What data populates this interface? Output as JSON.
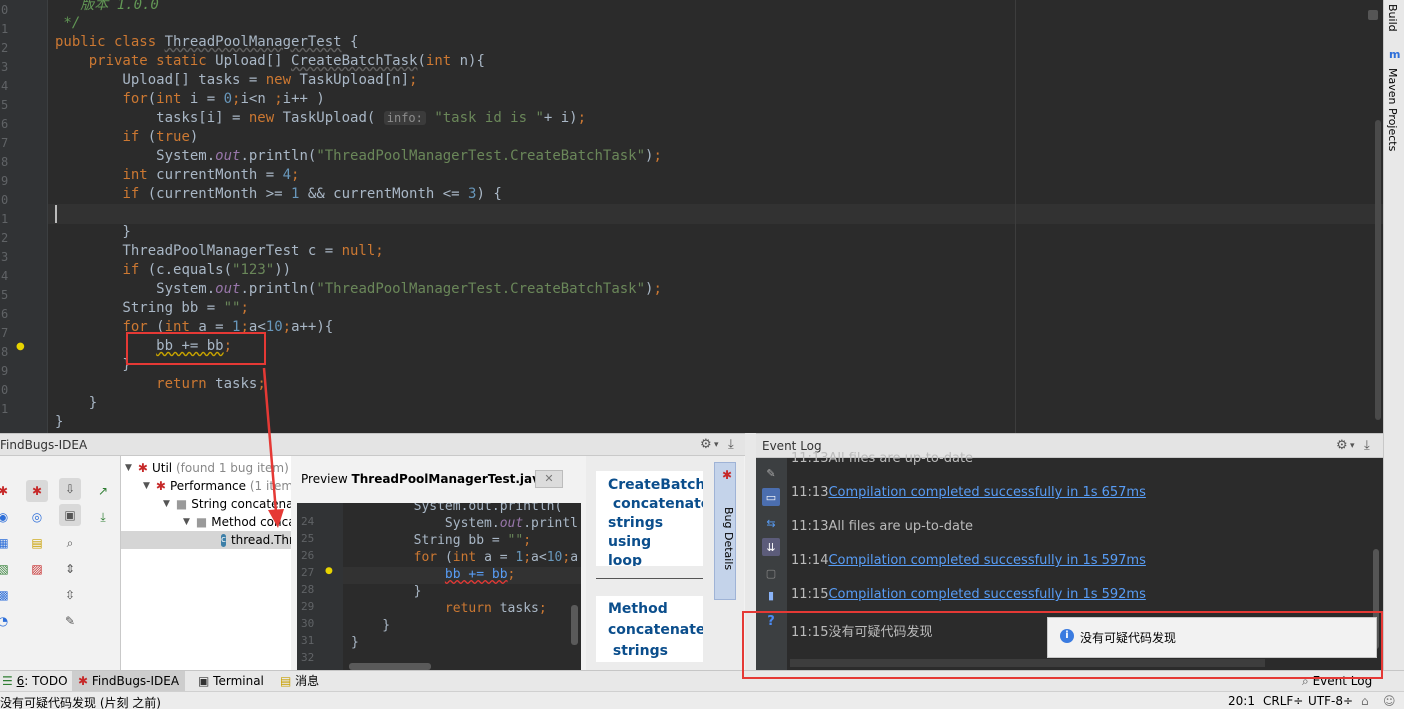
{
  "editor": {
    "gutter_numbers": [
      "0",
      "1",
      "2",
      "3",
      "4",
      "5",
      "6",
      "7",
      "8",
      "9",
      "0",
      "1",
      "2",
      "3",
      "4",
      "5",
      "6",
      "7",
      "8",
      "9",
      "0",
      "1"
    ],
    "hint_label": "info:"
  },
  "findbugs": {
    "title": "FindBugs-IDEA",
    "tree": {
      "util": "Util",
      "util_count": "(found 1 bug item)",
      "performance": "Performance",
      "performance_count": "(1 item)",
      "string_concat": "String concatenation",
      "method": "Method concatenates",
      "thread": "thread.ThreadPoolManagerTest"
    },
    "preview_label": "Preview",
    "preview_file": "ThreadPoolManagerTest.java:",
    "preview_close": "✕",
    "preview_lines": [
      "24",
      "25",
      "26",
      "27",
      "28",
      "29",
      "30",
      "31",
      "32"
    ],
    "details_top": [
      "CreateBatchT",
      " concatenates",
      "strings using",
      "loop"
    ],
    "details_bottom": [
      "Method",
      "concatenate",
      " strings"
    ],
    "bug_details_tab": "Bug Details"
  },
  "eventlog": {
    "title": "Event Log",
    "entries": [
      {
        "time": "11:13",
        "text": "All files are up-to-date",
        "link": false
      },
      {
        "time": "11:13",
        "text": "Compilation completed successfully in 1s 657ms",
        "link": true
      },
      {
        "time": "11:13",
        "text": "All files are up-to-date",
        "link": false
      },
      {
        "time": "11:14",
        "text": "Compilation completed successfully in 1s 597ms",
        "link": true
      },
      {
        "time": "11:15",
        "text": "Compilation completed successfully in 1s 592ms",
        "link": true
      },
      {
        "time": "11:15",
        "text": "没有可疑代码发现",
        "link": false
      }
    ],
    "balloon": "没有可疑代码发现"
  },
  "right_strip": {
    "build": "Build",
    "maven_icon": "m",
    "maven": "Maven Projects"
  },
  "toolbar": {
    "todo_num": "6",
    "todo": ": TODO",
    "findbugs": "FindBugs-IDEA",
    "terminal": "Terminal",
    "messages": "消息",
    "eventlog": "Event Log"
  },
  "status": {
    "message": "没有可疑代码发现 (片刻 之前)",
    "position": "20:1",
    "line_sep": "CRLF÷",
    "encoding": "UTF-8÷"
  },
  "colors": {
    "annotation_red": "#e53935",
    "link_blue": "#589df6",
    "keyword": "#cc7832",
    "string": "#6a8759"
  }
}
